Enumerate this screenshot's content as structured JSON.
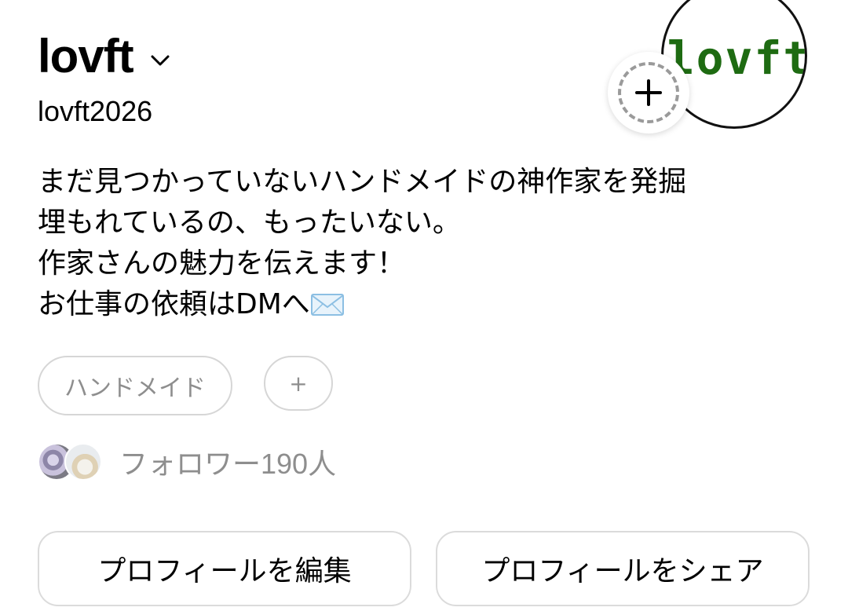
{
  "profile": {
    "display_name": "lovft",
    "username": "lovft2026",
    "avatar_text": "lovft",
    "bio_lines": [
      "まだ見つかっていないハンドメイドの神作家を発掘",
      "埋もれているの、もったいない。",
      "作家さんの魅力を伝えます！",
      "お仕事の依頼はDMへ"
    ],
    "bio_emoji": "envelope-icon"
  },
  "tags": {
    "items": [
      {
        "label": "ハンドメイド"
      }
    ],
    "add_label": "+"
  },
  "followers": {
    "label": "フォロワー190人"
  },
  "actions": {
    "edit_label": "プロフィールを編集",
    "share_label": "プロフィールをシェア"
  },
  "colors": {
    "avatar_text": "#1e6b12",
    "muted_text": "#8e8e8e",
    "border": "#dbdbdb"
  }
}
